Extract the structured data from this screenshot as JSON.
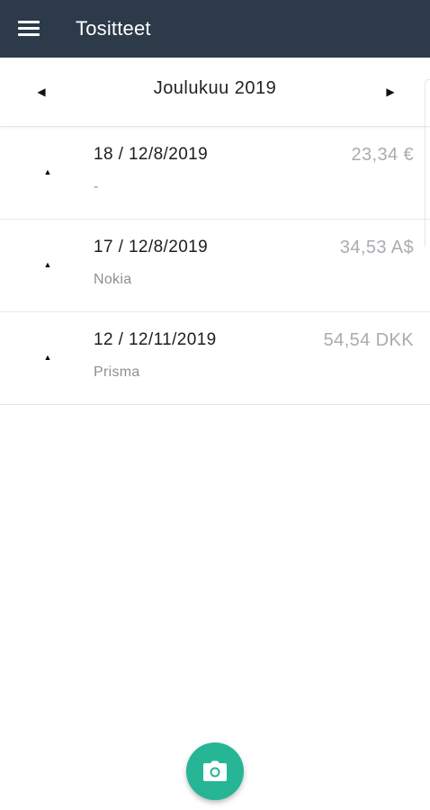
{
  "header": {
    "title": "Tositteet",
    "menu_icon": "hamburger-menu-icon",
    "background": "#2c3a4a"
  },
  "month_nav": {
    "label": "Joulukuu 2019",
    "prev_icon": "caret-left-icon",
    "next_icon": "caret-right-icon"
  },
  "receipts": [
    {
      "ref": "18 / 12/8/2019",
      "merchant": "-",
      "amount": "23,34 €"
    },
    {
      "ref": "17 / 12/8/2019",
      "merchant": "Nokia",
      "amount": "34,53 A$"
    },
    {
      "ref": "12 / 12/11/2019",
      "merchant": "Prisma",
      "amount": "54,54 DKK"
    }
  ],
  "fab": {
    "icon": "camera-icon",
    "color": "#26b595"
  }
}
